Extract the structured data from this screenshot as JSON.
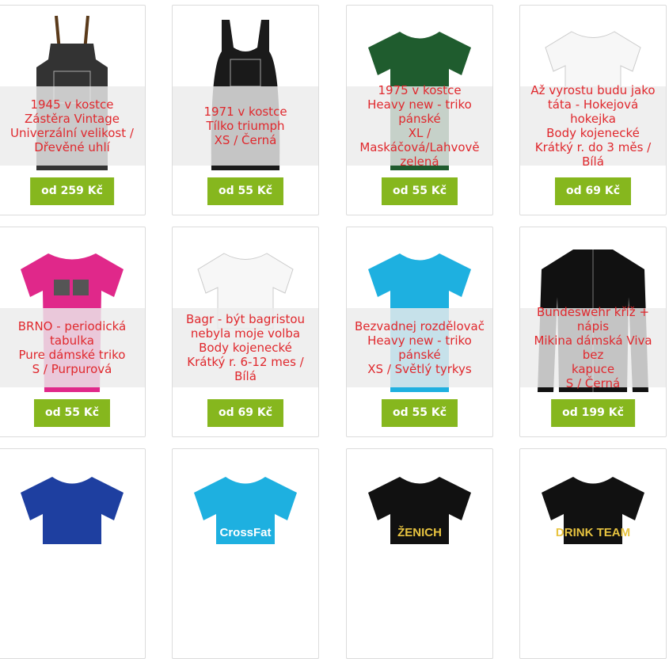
{
  "products": [
    {
      "title": "1945 v kostce\nZástěra Vintage\nUniverzální velikost /\nDřevěné uhlí",
      "price": "od 259 Kč",
      "image": "apron-icon",
      "garment_color": "#333333"
    },
    {
      "title": "1971 v kostce\nTílko triumph\nXS / Černá",
      "price": "od 55 Kč",
      "image": "tank-top-icon",
      "garment_color": "#1a1a1a"
    },
    {
      "title": "1975 v kostce\nHeavy new - triko pánské\nXL / Maskáčová/Lahvově\nzelená",
      "price": "od 55 Kč",
      "image": "tshirt-icon",
      "garment_color": "#1f5c2e"
    },
    {
      "title": "Až vyrostu budu jako\ntáta - Hokejová hokejka\nBody kojenecké\nKrátký r. do 3 měs / Bílá",
      "price": "od 69 Kč",
      "image": "baby-body-icon",
      "garment_color": "#f7f7f7"
    },
    {
      "title": "BRNO - periodická\ntabulka\nPure dámské triko\nS / Purpurová",
      "price": "od 55 Kč",
      "image": "womens-tshirt-icon",
      "garment_color": "#e0288a"
    },
    {
      "title": "Bagr - být bagristou\nnebyla moje volba\nBody kojenecké\nKrátký r. 6-12 mes / Bílá",
      "price": "od 69 Kč",
      "image": "baby-body-icon",
      "garment_color": "#f7f7f7"
    },
    {
      "title": "Bezvadnej rozdělovač\nHeavy new - triko pánské\nXS / Světlý tyrkys",
      "price": "od 55 Kč",
      "image": "tshirt-icon",
      "garment_color": "#1eb0e0"
    },
    {
      "title": "Bundeswehr kříž + nápis\nMikina dámská Viva bez\nkapuce\nS / Černá",
      "price": "od 199 Kč",
      "image": "jacket-icon",
      "garment_color": "#111111"
    },
    {
      "title": "",
      "price": "",
      "image": "tshirt-icon",
      "garment_color": "#1e3fa0"
    },
    {
      "title": "",
      "price": "",
      "image": "tshirt-icon",
      "garment_color": "#1eb0e0",
      "print": "CrossFat"
    },
    {
      "title": "",
      "price": "",
      "image": "tshirt-icon",
      "garment_color": "#111111",
      "print": "ŽENICH"
    },
    {
      "title": "",
      "price": "",
      "image": "tshirt-icon",
      "garment_color": "#111111",
      "print": "DRINK TEAM"
    }
  ],
  "colors": {
    "accent": "#86b71e",
    "title": "#e0282d"
  }
}
